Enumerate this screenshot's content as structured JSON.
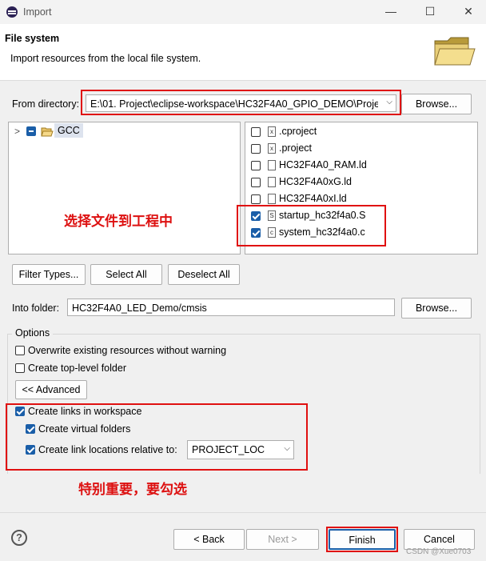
{
  "window": {
    "title": "Import",
    "minimize": "—",
    "maximize": "☐",
    "close": "✕"
  },
  "header": {
    "title": "File system",
    "description": "Import resources from the local file system."
  },
  "from_directory": {
    "label": "From directory:",
    "value": "E:\\01. Project\\eclipse-workspace\\HC32F4A0_GPIO_DEMO\\Proje",
    "browse": "Browse..."
  },
  "tree": {
    "expand_glyph": ">",
    "root_label": "GCC"
  },
  "files": [
    {
      "name": ".cproject",
      "checked": false,
      "icon": "xml-file-icon"
    },
    {
      "name": ".project",
      "checked": false,
      "icon": "xml-file-icon"
    },
    {
      "name": "HC32F4A0_RAM.ld",
      "checked": false,
      "icon": "file-icon"
    },
    {
      "name": "HC32F4A0xG.ld",
      "checked": false,
      "icon": "file-icon"
    },
    {
      "name": "HC32F4A0xI.ld",
      "checked": false,
      "icon": "file-icon"
    },
    {
      "name": "startup_hc32f4a0.S",
      "checked": true,
      "icon": "asm-file-icon"
    },
    {
      "name": "system_hc32f4a0.c",
      "checked": true,
      "icon": "c-file-icon"
    }
  ],
  "annotations": {
    "select_files": "选择文件到工程中",
    "important": "特别重要，要勾选"
  },
  "buttons": {
    "filter_types": "Filter Types...",
    "select_all": "Select All",
    "deselect_all": "Deselect All"
  },
  "into_folder": {
    "label": "Into folder:",
    "value": "HC32F4A0_LED_Demo/cmsis",
    "browse": "Browse..."
  },
  "options": {
    "title": "Options",
    "overwrite": "Overwrite existing resources without warning",
    "top_level": "Create top-level folder",
    "advanced": "<< Advanced",
    "create_links": "Create links in workspace",
    "virtual_folders": "Create virtual folders",
    "link_relative": "Create link locations relative to:",
    "relative_value": "PROJECT_LOC"
  },
  "footer": {
    "help": "?",
    "back": "< Back",
    "next": "Next >",
    "finish": "Finish",
    "cancel": "Cancel",
    "watermark": "CSDN @Xue0703"
  },
  "colors": {
    "accent": "#1a5ea8",
    "annotation": "#e01010"
  }
}
